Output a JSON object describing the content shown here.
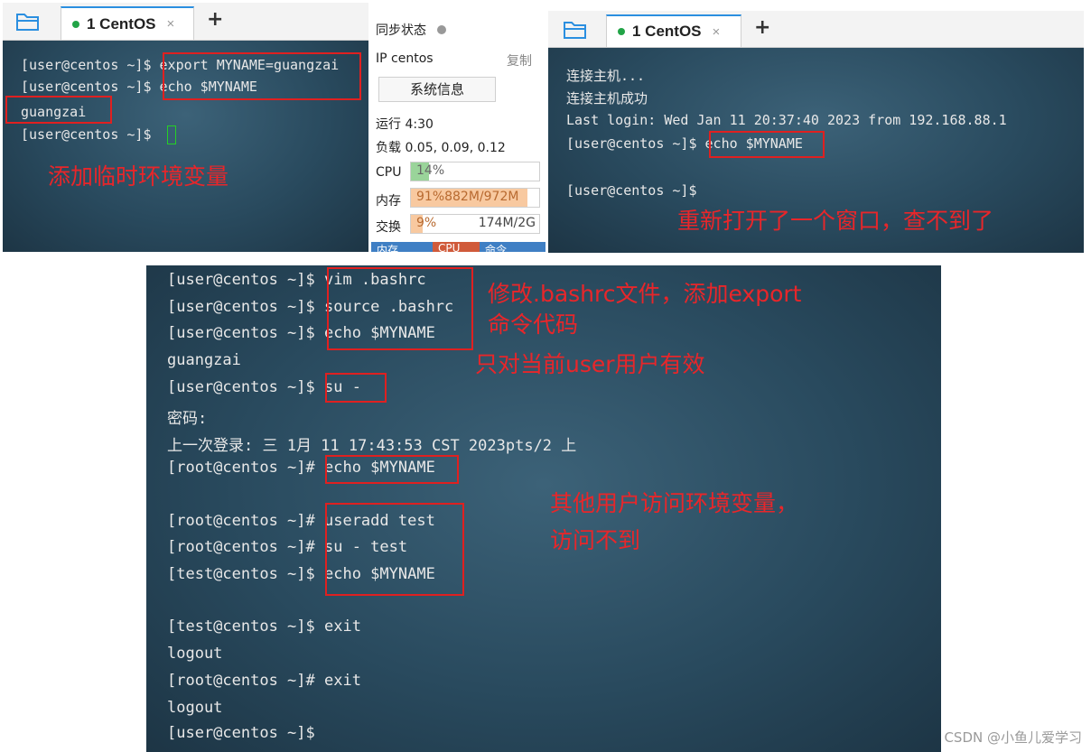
{
  "left_terminal": {
    "tab_label": "1 CentOS",
    "close": "×",
    "plus": "+",
    "lines": [
      "[user@centos ~]$ export MYNAME=guangzai",
      "[user@centos ~]$ echo $MYNAME",
      "guangzai",
      "[user@centos ~]$ "
    ],
    "annotation": "添加临时环境变量"
  },
  "status_panel": {
    "sync_label": "同步状态",
    "ip_label": "IP centos",
    "copy_label": "复制",
    "sysinfo_button": "系统信息",
    "uptime": "运行 4:30",
    "load": "负载 0.05, 0.09, 0.12",
    "cpu": {
      "label": "CPU",
      "text": "14%",
      "fraction": 0.14
    },
    "mem": {
      "label": "内存",
      "text": "91%882M/972M",
      "fraction": 0.91
    },
    "swap": {
      "label": "交换",
      "text": "9%",
      "text2": "174M/2G",
      "fraction": 0.09
    },
    "bottom_tabs": [
      "内存",
      "CPU",
      "命令"
    ]
  },
  "right_terminal": {
    "tab_label": "1 CentOS",
    "close": "×",
    "plus": "+",
    "lines": [
      "连接主机...",
      "连接主机成功",
      "Last login: Wed Jan 11 20:37:40 2023 from 192.168.88.1",
      "[user@centos ~]$ echo $MYNAME",
      "",
      "[user@centos ~]$"
    ],
    "annotation": "重新打开了一个窗口，查不到了"
  },
  "bottom_terminal": {
    "lines": [
      "[user@centos ~]$ vim .bashrc",
      "[user@centos ~]$ source .bashrc",
      "[user@centos ~]$ echo $MYNAME",
      "guangzai",
      "[user@centos ~]$ su -",
      "密码:",
      "上一次登录: 三 1月 11 17:43:53 CST 2023pts/2 上",
      "[root@centos ~]# echo $MYNAME",
      "",
      "[root@centos ~]# useradd test",
      "[root@centos ~]# su - test",
      "[test@centos ~]$ echo $MYNAME",
      "",
      "[test@centos ~]$ exit",
      "logout",
      "[root@centos ~]# exit",
      "logout",
      "[user@centos ~]$"
    ],
    "annotation_1": "修改.bashrc文件，添加export",
    "annotation_2": "命令代码",
    "annotation_3": "只对当前user用户有效",
    "annotation_4": "其他用户访问环境变量，",
    "annotation_5": "访问不到"
  },
  "watermark": "CSDN @小鱼儿爱学习",
  "colors": {
    "accent": "#2b8fe0",
    "annotation": "#e8262a",
    "cpu_fill": "#9ad49a",
    "mem_fill": "#f8c9a0"
  }
}
